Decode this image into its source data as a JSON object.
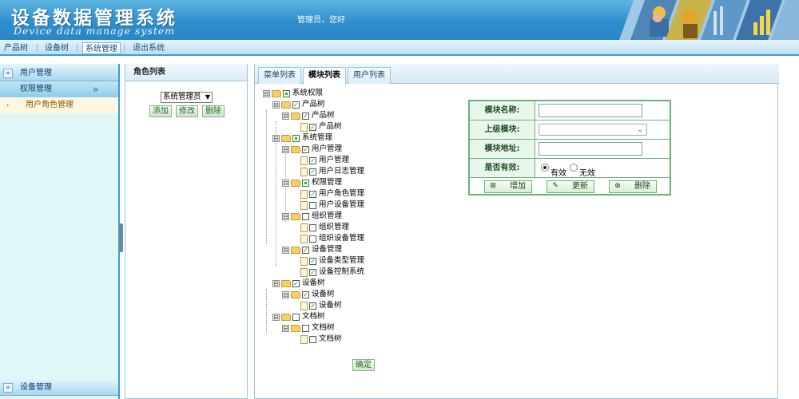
{
  "header": {
    "title": "设备数据管理系统",
    "subtitle": "Device data manage system",
    "welcome": "管理员，您好"
  },
  "nav": {
    "items": [
      "产品树",
      "设备树",
      "系统管理",
      "退出系统"
    ],
    "active": "系统管理"
  },
  "sidebar": {
    "user_mgmt": "用户管理",
    "perm_mgmt": "权限管理",
    "sub_item": "用户角色管理",
    "device_mgmt": "设备管理",
    "expand_glyph": "»"
  },
  "role_panel": {
    "title": "角色列表",
    "selected_role": "系统管理员",
    "buttons": {
      "add": "添加",
      "edit": "修改",
      "delete": "删除"
    }
  },
  "tabs": [
    "菜单列表",
    "模块列表",
    "用户列表"
  ],
  "active_tab": "模块列表",
  "tree": [
    {
      "label": "系统权限",
      "checked": "partial"
    },
    {
      "label": "产品树",
      "checked": "yes"
    },
    {
      "label": "产品树",
      "checked": "yes"
    },
    {
      "label": "产品树",
      "checked": "yes"
    },
    {
      "label": "系统管理",
      "checked": "partial"
    },
    {
      "label": "用户管理",
      "checked": "yes"
    },
    {
      "label": "用户管理",
      "checked": "yes"
    },
    {
      "label": "用户日志管理",
      "checked": "yes"
    },
    {
      "label": "权限管理",
      "checked": "partial"
    },
    {
      "label": "用户角色管理",
      "checked": "yes"
    },
    {
      "label": "用户设备管理",
      "checked": "no"
    },
    {
      "label": "组织管理",
      "checked": "no"
    },
    {
      "label": "组织管理",
      "checked": "no"
    },
    {
      "label": "组织设备管理",
      "checked": "no"
    },
    {
      "label": "设备管理",
      "checked": "yes"
    },
    {
      "label": "设备类型管理",
      "checked": "yes"
    },
    {
      "label": "设备控制系统",
      "checked": "yes"
    },
    {
      "label": "设备树",
      "checked": "yes"
    },
    {
      "label": "设备树",
      "checked": "yes"
    },
    {
      "label": "设备树",
      "checked": "yes"
    },
    {
      "label": "文档树",
      "checked": "no"
    },
    {
      "label": "文档树",
      "checked": "no"
    },
    {
      "label": "文档树",
      "checked": "no"
    }
  ],
  "confirm_label": "确定",
  "form": {
    "name_label": "模块名称:",
    "parent_label": "上级模块:",
    "address_label": "模块地址:",
    "valid_label": "是否有效:",
    "name_value": "",
    "parent_value": "",
    "address_value": "",
    "radio_valid": "有效",
    "radio_invalid": "无效",
    "valid_selected": "有效",
    "btn_add": "增加",
    "btn_update": "更新",
    "btn_delete": "删除"
  },
  "colors": {
    "header_blue": "#2f8ecd",
    "sidebar_bg": "#e1f7f7",
    "form_border": "#6bb17a",
    "nav_accent": "#3d9cd9"
  },
  "icons": {
    "plus": "⊞",
    "minus": "⊟",
    "check": "✓",
    "add_icon": "⊞",
    "edit_icon": "✎",
    "delete_icon": "⊗",
    "dropdown": "▼"
  }
}
